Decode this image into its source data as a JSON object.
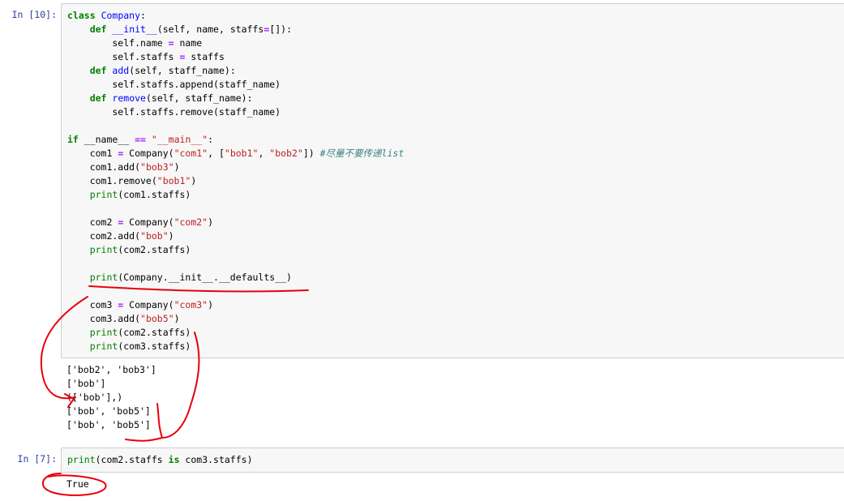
{
  "cell1": {
    "prompt": "In [10]:",
    "code_lines": [
      [
        [
          "kw",
          "class"
        ],
        [
          "t",
          " "
        ],
        [
          "fn",
          "Company"
        ],
        [
          "t",
          ":"
        ]
      ],
      [
        [
          "t",
          "    "
        ],
        [
          "kw",
          "def"
        ],
        [
          "t",
          " "
        ],
        [
          "fn",
          "__init__"
        ],
        [
          "t",
          "(self, name, staffs"
        ],
        [
          "op",
          "="
        ],
        [
          "t",
          "[]):"
        ]
      ],
      [
        [
          "t",
          "        self.name "
        ],
        [
          "op",
          "="
        ],
        [
          "t",
          " name"
        ]
      ],
      [
        [
          "t",
          "        self.staffs "
        ],
        [
          "op",
          "="
        ],
        [
          "t",
          " staffs"
        ]
      ],
      [
        [
          "t",
          "    "
        ],
        [
          "kw",
          "def"
        ],
        [
          "t",
          " "
        ],
        [
          "fn",
          "add"
        ],
        [
          "t",
          "(self, staff_name):"
        ]
      ],
      [
        [
          "t",
          "        self.staffs.append(staff_name)"
        ]
      ],
      [
        [
          "t",
          "    "
        ],
        [
          "kw",
          "def"
        ],
        [
          "t",
          " "
        ],
        [
          "fn",
          "remove"
        ],
        [
          "t",
          "(self, staff_name):"
        ]
      ],
      [
        [
          "t",
          "        self.staffs.remove(staff_name)"
        ]
      ],
      [
        [
          "t",
          ""
        ]
      ],
      [
        [
          "kw",
          "if"
        ],
        [
          "t",
          " __name__ "
        ],
        [
          "op",
          "=="
        ],
        [
          "t",
          " "
        ],
        [
          "str",
          "\"__main__\""
        ],
        [
          "t",
          ":"
        ]
      ],
      [
        [
          "t",
          "    com1 "
        ],
        [
          "op",
          "="
        ],
        [
          "t",
          " Company("
        ],
        [
          "str",
          "\"com1\""
        ],
        [
          "t",
          ", ["
        ],
        [
          "str",
          "\"bob1\""
        ],
        [
          "t",
          ", "
        ],
        [
          "str",
          "\"bob2\""
        ],
        [
          "t",
          "]) "
        ],
        [
          "cm",
          "#尽量不要传递list"
        ]
      ],
      [
        [
          "t",
          "    com1.add("
        ],
        [
          "str",
          "\"bob3\""
        ],
        [
          "t",
          ")"
        ]
      ],
      [
        [
          "t",
          "    com1.remove("
        ],
        [
          "str",
          "\"bob1\""
        ],
        [
          "t",
          ")"
        ]
      ],
      [
        [
          "t",
          "    "
        ],
        [
          "kw2",
          "print"
        ],
        [
          "t",
          "(com1.staffs)"
        ]
      ],
      [
        [
          "t",
          ""
        ]
      ],
      [
        [
          "t",
          "    com2 "
        ],
        [
          "op",
          "="
        ],
        [
          "t",
          " Company("
        ],
        [
          "str",
          "\"com2\""
        ],
        [
          "t",
          ")"
        ]
      ],
      [
        [
          "t",
          "    com2.add("
        ],
        [
          "str",
          "\"bob\""
        ],
        [
          "t",
          ")"
        ]
      ],
      [
        [
          "t",
          "    "
        ],
        [
          "kw2",
          "print"
        ],
        [
          "t",
          "(com2.staffs)"
        ]
      ],
      [
        [
          "t",
          ""
        ]
      ],
      [
        [
          "t",
          "    "
        ],
        [
          "kw2",
          "print"
        ],
        [
          "t",
          "(Company.__init__.__defaults__)"
        ]
      ],
      [
        [
          "t",
          ""
        ]
      ],
      [
        [
          "t",
          "    com3 "
        ],
        [
          "op",
          "="
        ],
        [
          "t",
          " Company("
        ],
        [
          "str",
          "\"com3\""
        ],
        [
          "t",
          ")"
        ]
      ],
      [
        [
          "t",
          "    com3.add("
        ],
        [
          "str",
          "\"bob5\""
        ],
        [
          "t",
          ")"
        ]
      ],
      [
        [
          "t",
          "    "
        ],
        [
          "kw2",
          "print"
        ],
        [
          "t",
          "(com2.staffs)"
        ]
      ],
      [
        [
          "t",
          "    "
        ],
        [
          "kw2",
          "print"
        ],
        [
          "t",
          "(com3.staffs)"
        ]
      ]
    ],
    "output_lines": [
      "['bob2', 'bob3']",
      "['bob']",
      "(['bob'],)",
      "['bob', 'bob5']",
      "['bob', 'bob5']"
    ]
  },
  "cell2": {
    "prompt": "In [7]:",
    "code_lines": [
      [
        [
          "kw2",
          "print"
        ],
        [
          "t",
          "(com2.staffs "
        ],
        [
          "kw",
          "is"
        ],
        [
          "t",
          " com3.staffs)"
        ]
      ]
    ],
    "output_lines": [
      "True"
    ]
  },
  "annotation_color": "#e8000b"
}
